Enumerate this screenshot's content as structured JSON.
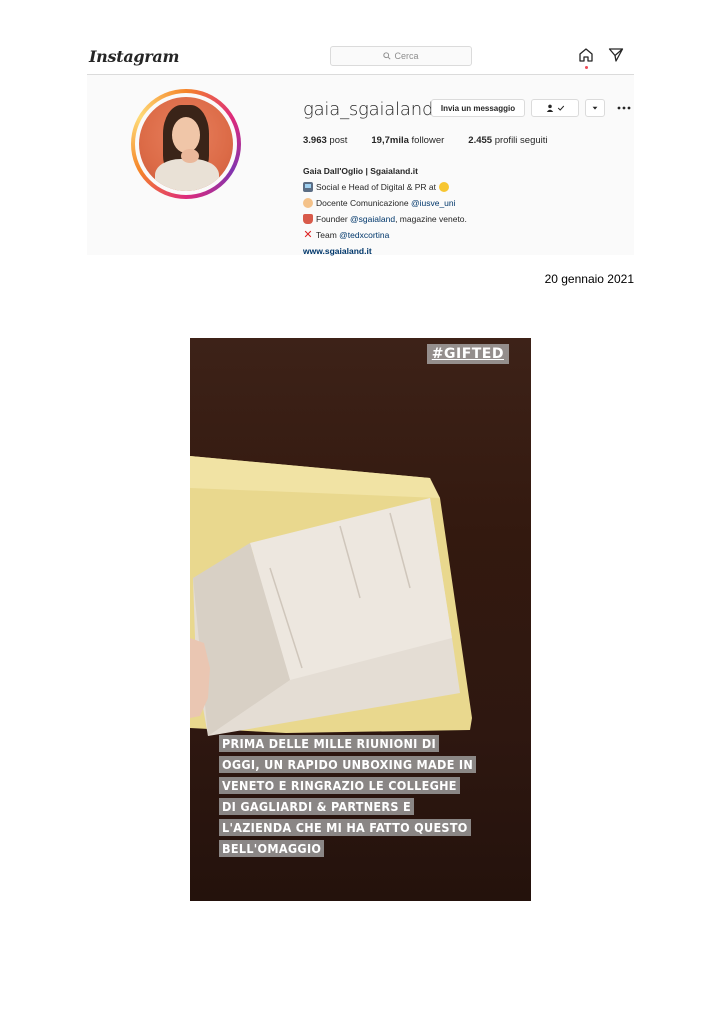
{
  "header": {
    "logo_text": "Instagram",
    "search_placeholder": "Cerca",
    "icons": [
      "home-icon",
      "direct-message-icon"
    ]
  },
  "profile": {
    "username": "gaia_sgaialand",
    "message_button": "Invia un messaggio",
    "follow_icon": "person-check-icon",
    "dropdown_icon": "caret-down-icon",
    "more_icon": "more-dots-icon",
    "stats": {
      "posts_value": "3.963",
      "posts_label": "post",
      "followers_value": "19,7mila",
      "followers_label": "follower",
      "following_value": "2.455",
      "following_label": "profili seguiti"
    },
    "bio": {
      "name": "Gaia Dall'Oglio | Sgaialand.it",
      "line1": "Social e Head of Digital & PR at",
      "line2_text": "Docente Comunicazione",
      "line2_mention": "@iusve_uni",
      "line3_text": "Founder",
      "line3_mention": "@sgaialand",
      "line3_suffix": ", magazine veneto.",
      "line4_text": "Team",
      "line4_mention": "@tedxcortina",
      "link": "www.sgaialand.it"
    }
  },
  "date": "20 gennaio 2021",
  "story": {
    "tag": "#GIFTED",
    "caption_lines": [
      "Prima delle mille riunioni di",
      "oggi, un rapido unboxing made in",
      "Veneto e ringrazio le colleghe",
      "di Gagliardi & Partners e",
      "l'azienda che mi ha fatto questo",
      "bell'omaggio"
    ]
  }
}
